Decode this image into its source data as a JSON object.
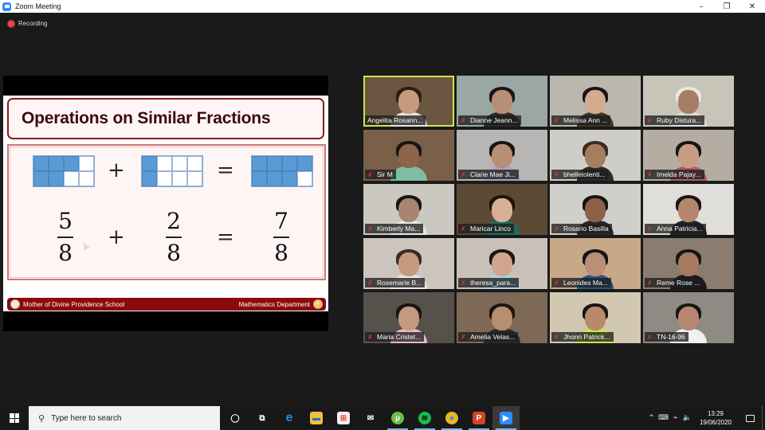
{
  "window": {
    "title": "Zoom Meeting",
    "controls": {
      "minimize": "–",
      "restore": "❐",
      "close": "✕"
    }
  },
  "recording": {
    "label": "Recording",
    "color": "#e0483f"
  },
  "shared_screen": {
    "title": "Operations on Similar Fractions",
    "equation": {
      "plus": "+",
      "equals": "=",
      "fractions": [
        {
          "numerator": "5",
          "denominator": "8",
          "filled_cells": [
            0,
            1,
            2,
            4,
            5
          ]
        },
        {
          "numerator": "2",
          "denominator": "8",
          "filled_cells": [
            0,
            4
          ]
        },
        {
          "numerator": "7",
          "denominator": "8",
          "filled_cells": [
            0,
            1,
            2,
            3,
            4,
            5,
            6
          ]
        }
      ]
    },
    "footer": {
      "left": "Mother of Divine Providence School",
      "right": "Mathematics Department"
    },
    "colors": {
      "accent": "#8b0a0a",
      "fill": "#5b9bd5"
    }
  },
  "participants": [
    {
      "name": "Angelita Rosann...",
      "muted": false,
      "active": true,
      "bg": "#6b5540",
      "skin": "#c89a7d",
      "shirt": "#e8e4e0",
      "hair": "#2a1e17"
    },
    {
      "name": "Dianne Jeann...",
      "muted": true,
      "bg": "#9aa7a2",
      "skin": "#b88e74",
      "shirt": "#2a2a2a",
      "hair": "#1a1512"
    },
    {
      "name": "Melissa Ann ...",
      "muted": true,
      "bg": "#b9b7ae",
      "skin": "#d5ab90",
      "shirt": "#403525",
      "hair": "#1a1512"
    },
    {
      "name": "Ruby Distura...",
      "muted": true,
      "bg": "#c7c4b8",
      "skin": "#a77c66",
      "shirt": "#e0ddd7",
      "hair": "#e8e6e0"
    },
    {
      "name": "Sir M",
      "muted": true,
      "bg": "#7a6048",
      "skin": "#8e644a",
      "shirt": "#7ebea3",
      "hair": "#1a1512"
    },
    {
      "name": "Clarie Mae Ji...",
      "muted": true,
      "bg": "#b8b6b4",
      "skin": "#b78e76",
      "shirt": "#a8a4c0",
      "hair": "#1a1512"
    },
    {
      "name": "bhelletolenti...",
      "muted": true,
      "bg": "#cfcdc8",
      "skin": "#a57e62",
      "shirt": "#2b2b2b",
      "hair": "#3a2c22"
    },
    {
      "name": "Imelda Pajay...",
      "muted": true,
      "bg": "#b6ada2",
      "skin": "#c79c86",
      "shirt": "#b05a5a",
      "hair": "#1a1512"
    },
    {
      "name": "Kimberly Ma...",
      "muted": true,
      "bg": "#cbc7c1",
      "skin": "#a88570",
      "shirt": "#e6e6ea",
      "hair": "#1a1512"
    },
    {
      "name": "Maricar Linco",
      "muted": true,
      "bg": "#5c4a35",
      "skin": "#d9b095",
      "shirt": "#1f6b5a",
      "hair": "#1a1512"
    },
    {
      "name": "Rosario Basilla",
      "muted": true,
      "bg": "#d0cfcc",
      "skin": "#8d6048",
      "shirt": "#2a2a2a",
      "hair": "#1a1512"
    },
    {
      "name": "Anna Patricia...",
      "muted": true,
      "bg": "#e0dedb",
      "skin": "#b5866c",
      "shirt": "#222222",
      "hair": "#1a1512"
    },
    {
      "name": "Rosemarie B...",
      "muted": true,
      "bg": "#cbc5bd",
      "skin": "#c39a80",
      "shirt": "#e8e8ea",
      "hair": "#3a2a20"
    },
    {
      "name": "theresa_para...",
      "muted": true,
      "bg": "#c9c1b7",
      "skin": "#d0a58c",
      "shirt": "#a8d4e2",
      "hair": "#1a1512"
    },
    {
      "name": "Leonides Ma...",
      "muted": true,
      "bg": "#c8a987",
      "skin": "#b98f78",
      "shirt": "#2a5580",
      "hair": "#1a1512"
    },
    {
      "name": "Reme Rose ...",
      "muted": true,
      "bg": "#8a7d70",
      "skin": "#a67a60",
      "shirt": "#1a1a1a",
      "hair": "#1a1512"
    },
    {
      "name": "Maria Cristet...",
      "muted": true,
      "bg": "#57514c",
      "skin": "#c39a80",
      "shirt": "#eab9c9",
      "hair": "#1a1512"
    },
    {
      "name": "Amelia Velas...",
      "muted": true,
      "bg": "#7d6955",
      "skin": "#b78e70",
      "shirt": "#2a2a2a",
      "hair": "#1a1512"
    },
    {
      "name": "Jhonn Patrick...",
      "muted": true,
      "bg": "#d2c7b0",
      "skin": "#b88a6c",
      "shirt": "#c8e850",
      "hair": "#1a1512"
    },
    {
      "name": "TN-16-96",
      "muted": true,
      "bg": "#8e8b85",
      "skin": "#b88770",
      "shirt": "#f0f0f0",
      "hair": "#1a1512"
    }
  ],
  "taskbar": {
    "search_placeholder": "Type here to search",
    "apps": [
      {
        "name": "cortana",
        "glyph": "◯",
        "color": "transparent",
        "fg": "#ffffff"
      },
      {
        "name": "task-view",
        "glyph": "⧉",
        "color": "transparent",
        "fg": "#ffffff"
      },
      {
        "name": "edge",
        "glyph": "e",
        "color": "transparent",
        "fg": "#1e8be0",
        "running": false
      },
      {
        "name": "file-explorer",
        "glyph": "▬",
        "color": "#f0c040",
        "fg": "#2a6fb5"
      },
      {
        "name": "store",
        "glyph": "⊞",
        "color": "#f2f2f2",
        "fg": "#e44"
      },
      {
        "name": "mail",
        "glyph": "✉",
        "color": "transparent",
        "fg": "#ffffff"
      },
      {
        "name": "utorrent",
        "glyph": "µ",
        "color": "#6cbd45",
        "fg": "#ffffff",
        "running": true
      },
      {
        "name": "spotify",
        "glyph": "≋",
        "color": "#1db954",
        "fg": "#111111",
        "running": true
      },
      {
        "name": "chrome",
        "glyph": "●",
        "color": "#e9b820",
        "fg": "#4285f4",
        "running": true
      },
      {
        "name": "powerpoint",
        "glyph": "P",
        "color": "#d04525",
        "fg": "#ffffff",
        "running": true
      },
      {
        "name": "zoom",
        "glyph": "▶",
        "color": "#2d8cff",
        "fg": "#ffffff",
        "running": true,
        "active": true
      }
    ],
    "tray": {
      "chevron": "^",
      "network": "⌁",
      "volume": "🔈",
      "time": "13:29",
      "date": "19/06/2020"
    }
  }
}
